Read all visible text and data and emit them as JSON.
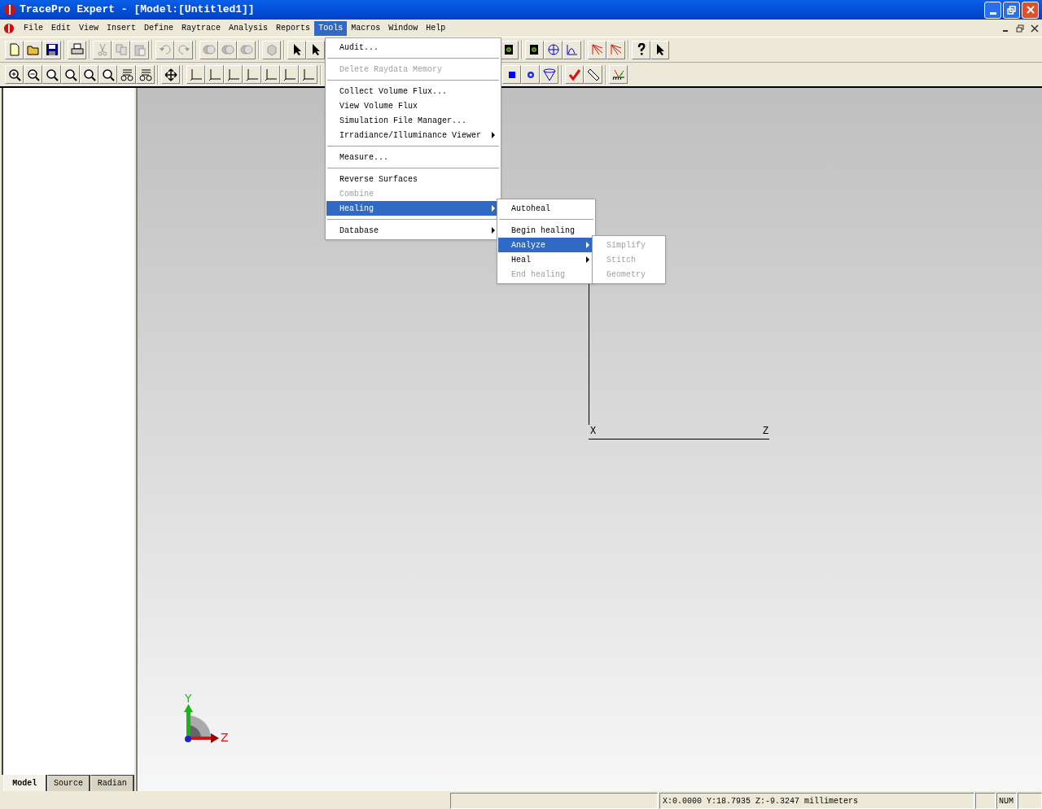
{
  "window": {
    "title": "TracePro Expert - [Model:[Untitled1]]"
  },
  "menu_bar": [
    {
      "label": "File",
      "selected": false
    },
    {
      "label": "Edit",
      "selected": false
    },
    {
      "label": "View",
      "selected": false
    },
    {
      "label": "Insert",
      "selected": false
    },
    {
      "label": "Define",
      "selected": false
    },
    {
      "label": "Raytrace",
      "selected": false
    },
    {
      "label": "Analysis",
      "selected": false
    },
    {
      "label": "Reports",
      "selected": false
    },
    {
      "label": "Tools",
      "selected": true
    },
    {
      "label": "Macros",
      "selected": false
    },
    {
      "label": "Window",
      "selected": false
    },
    {
      "label": "Help",
      "selected": false
    }
  ],
  "tools_menu": [
    {
      "kind": "item",
      "label": "Audit...",
      "disabled": false,
      "selected": false,
      "submenu": false
    },
    {
      "kind": "separator"
    },
    {
      "kind": "item",
      "label": "Delete Raydata Memory",
      "disabled": true,
      "selected": false,
      "submenu": false
    },
    {
      "kind": "separator"
    },
    {
      "kind": "item",
      "label": "Collect Volume Flux...",
      "disabled": false,
      "selected": false,
      "submenu": false
    },
    {
      "kind": "item",
      "label": "View Volume Flux",
      "disabled": false,
      "selected": false,
      "submenu": false
    },
    {
      "kind": "item",
      "label": "Simulation File Manager...",
      "disabled": false,
      "selected": false,
      "submenu": false
    },
    {
      "kind": "item",
      "label": "Irradiance/Illuminance Viewer",
      "disabled": false,
      "selected": false,
      "submenu": true
    },
    {
      "kind": "separator"
    },
    {
      "kind": "item",
      "label": "Measure...",
      "disabled": false,
      "selected": false,
      "submenu": false
    },
    {
      "kind": "separator"
    },
    {
      "kind": "item",
      "label": "Reverse Surfaces",
      "disabled": false,
      "selected": false,
      "submenu": false
    },
    {
      "kind": "item",
      "label": "Combine",
      "disabled": true,
      "selected": false,
      "submenu": false
    },
    {
      "kind": "item",
      "label": "Healing",
      "disabled": false,
      "selected": true,
      "submenu": true
    },
    {
      "kind": "separator"
    },
    {
      "kind": "item",
      "label": "Database",
      "disabled": false,
      "selected": false,
      "submenu": true
    }
  ],
  "healing_submenu": [
    {
      "kind": "item",
      "label": "Autoheal",
      "disabled": false,
      "selected": false,
      "submenu": false
    },
    {
      "kind": "separator"
    },
    {
      "kind": "item",
      "label": "Begin healing",
      "disabled": false,
      "selected": false,
      "submenu": false
    },
    {
      "kind": "item",
      "label": "Analyze",
      "disabled": false,
      "selected": true,
      "submenu": true
    },
    {
      "kind": "item",
      "label": "Heal",
      "disabled": false,
      "selected": false,
      "submenu": true
    },
    {
      "kind": "item",
      "label": "End healing",
      "disabled": true,
      "selected": false,
      "submenu": false
    }
  ],
  "analyze_submenu": [
    {
      "kind": "item",
      "label": "Simplify",
      "disabled": true,
      "selected": false,
      "submenu": false
    },
    {
      "kind": "item",
      "label": "Stitch",
      "disabled": true,
      "selected": false,
      "submenu": false
    },
    {
      "kind": "item",
      "label": "Geometry",
      "disabled": true,
      "selected": false,
      "submenu": false
    }
  ],
  "tree_tabs": [
    {
      "label": "Model",
      "selected": true
    },
    {
      "label": "Source",
      "selected": false
    },
    {
      "label": "Radian",
      "selected": false
    }
  ],
  "viewport": {
    "axis_labels": [
      "X",
      "Z"
    ],
    "triad_labels": [
      "Y",
      "Z"
    ]
  },
  "status_bar": {
    "coordinates": "X:0.0000 Y:18.7935 Z:-9.3247 millimeters",
    "num": "NUM"
  }
}
